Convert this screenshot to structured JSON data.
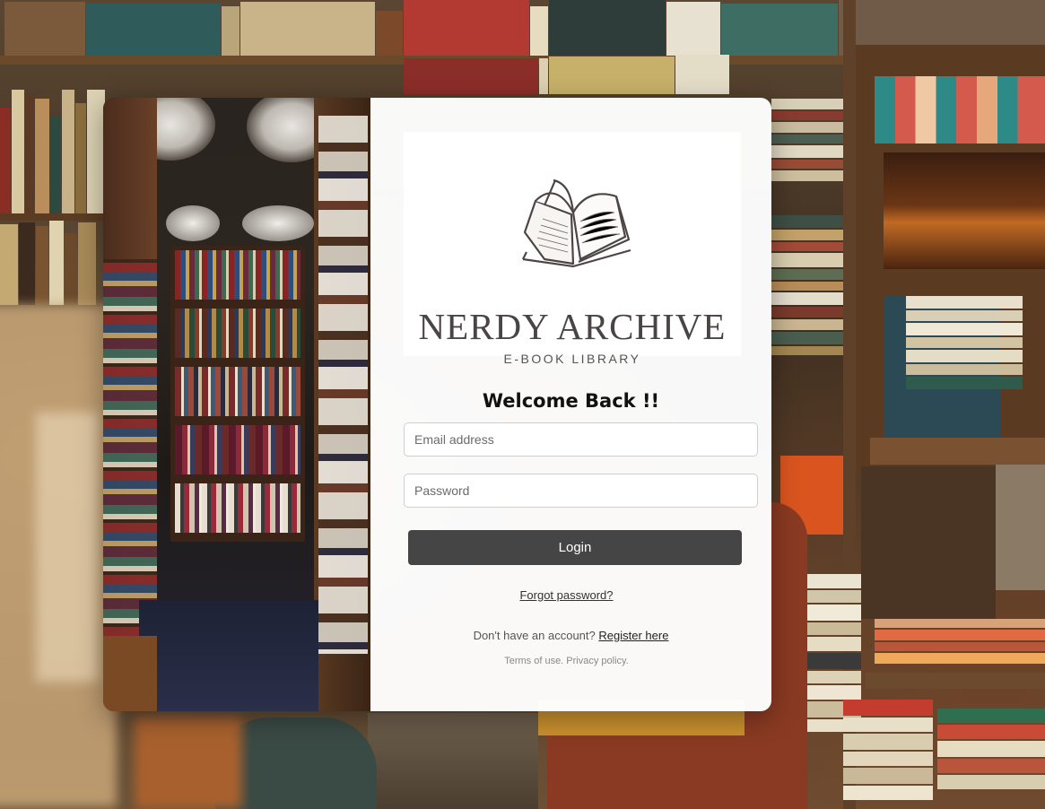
{
  "brand": {
    "name": "NERDY ARCHIVE",
    "subtitle": "E-BOOK LIBRARY"
  },
  "form": {
    "heading": "Welcome Back !!",
    "email_placeholder": "Email address",
    "password_placeholder": "Password",
    "login_label": "Login",
    "forgot_label": "Forgot password?",
    "no_account_text": "Don't have an account?",
    "register_label": "Register here",
    "terms_text": "Terms of use. Privacy policy."
  },
  "colors": {
    "button": "#454545",
    "panel": "#ffffff",
    "heading": "#111111"
  }
}
